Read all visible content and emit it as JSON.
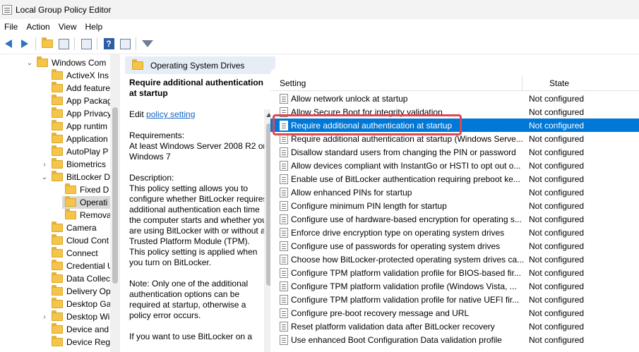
{
  "window": {
    "title": "Local Group Policy Editor"
  },
  "menu": [
    "File",
    "Action",
    "View",
    "Help"
  ],
  "toolbar": {
    "icons": [
      "back-arrow-icon",
      "forward-arrow-icon",
      "up-folder-icon",
      "show-hide-tree-icon",
      "export-list-icon",
      "help-icon",
      "properties-icon",
      "filter-icon"
    ]
  },
  "tree": {
    "items": [
      {
        "label": "Windows Com",
        "expanded": true
      },
      {
        "label": "ActiveX Ins"
      },
      {
        "label": "Add feature"
      },
      {
        "label": "App Packag"
      },
      {
        "label": "App Privacy"
      },
      {
        "label": "App runtim"
      },
      {
        "label": "Application"
      },
      {
        "label": "AutoPlay P"
      },
      {
        "label": "Biometrics",
        "collapsed": true
      },
      {
        "label": "BitLocker D",
        "expanded": true
      },
      {
        "label": "Fixed D"
      },
      {
        "label": "Operati",
        "selected": true
      },
      {
        "label": "Remova"
      },
      {
        "label": "Camera"
      },
      {
        "label": "Cloud Cont"
      },
      {
        "label": "Connect"
      },
      {
        "label": "Credential U"
      },
      {
        "label": "Data Collec"
      },
      {
        "label": "Delivery Op"
      },
      {
        "label": "Desktop Ga"
      },
      {
        "label": "Desktop Wi",
        "collapsed": true
      },
      {
        "label": "Device and"
      },
      {
        "label": "Device Reg"
      }
    ]
  },
  "description": {
    "header": "Operating System Drives",
    "title": "Require additional authentication at startup",
    "edit_prefix": "Edit ",
    "edit_link": "policy setting",
    "requirements_label": "Requirements:",
    "requirements": "At least Windows Server 2008 R2 or Windows 7",
    "description_label": "Description:",
    "description": "This policy setting allows you to configure whether BitLocker requires additional authentication each time the computer starts and whether you are using BitLocker with or without a Trusted Platform Module (TPM). This policy setting is applied when you turn on BitLocker.",
    "note": "Note: Only one of the additional authentication options can be required at startup, otherwise a policy error occurs.",
    "more": "If you want to use BitLocker on a"
  },
  "list": {
    "col_setting": "Setting",
    "col_state": "State",
    "rows": [
      {
        "name": "Allow network unlock at startup",
        "state": "Not configured"
      },
      {
        "name": "Allow Secure Boot for integrity validation",
        "state": "Not configured"
      },
      {
        "name": "Require additional authentication at startup",
        "state": "Not configured",
        "selected": true
      },
      {
        "name": "Require additional authentication at startup (Windows Serve...",
        "state": "Not configured"
      },
      {
        "name": "Disallow standard users from changing the PIN or password",
        "state": "Not configured"
      },
      {
        "name": "Allow devices compliant with InstantGo or HSTI to opt out o...",
        "state": "Not configured"
      },
      {
        "name": "Enable use of BitLocker authentication requiring preboot ke...",
        "state": "Not configured"
      },
      {
        "name": "Allow enhanced PINs for startup",
        "state": "Not configured"
      },
      {
        "name": "Configure minimum PIN length for startup",
        "state": "Not configured"
      },
      {
        "name": "Configure use of hardware-based encryption for operating s...",
        "state": "Not configured"
      },
      {
        "name": "Enforce drive encryption type on operating system drives",
        "state": "Not configured"
      },
      {
        "name": "Configure use of passwords for operating system drives",
        "state": "Not configured"
      },
      {
        "name": "Choose how BitLocker-protected operating system drives ca...",
        "state": "Not configured"
      },
      {
        "name": "Configure TPM platform validation profile for BIOS-based fir...",
        "state": "Not configured"
      },
      {
        "name": "Configure TPM platform validation profile (Windows Vista, ...",
        "state": "Not configured"
      },
      {
        "name": "Configure TPM platform validation profile for native UEFI fir...",
        "state": "Not configured"
      },
      {
        "name": "Configure pre-boot recovery message and URL",
        "state": "Not configured"
      },
      {
        "name": "Reset platform validation data after BitLocker recovery",
        "state": "Not configured"
      },
      {
        "name": "Use enhanced Boot Configuration Data validation profile",
        "state": "Not configured"
      }
    ]
  },
  "colors": {
    "selection": "#0078d7",
    "highlight_border": "#e04850",
    "header_bg": "#e6edf7"
  }
}
